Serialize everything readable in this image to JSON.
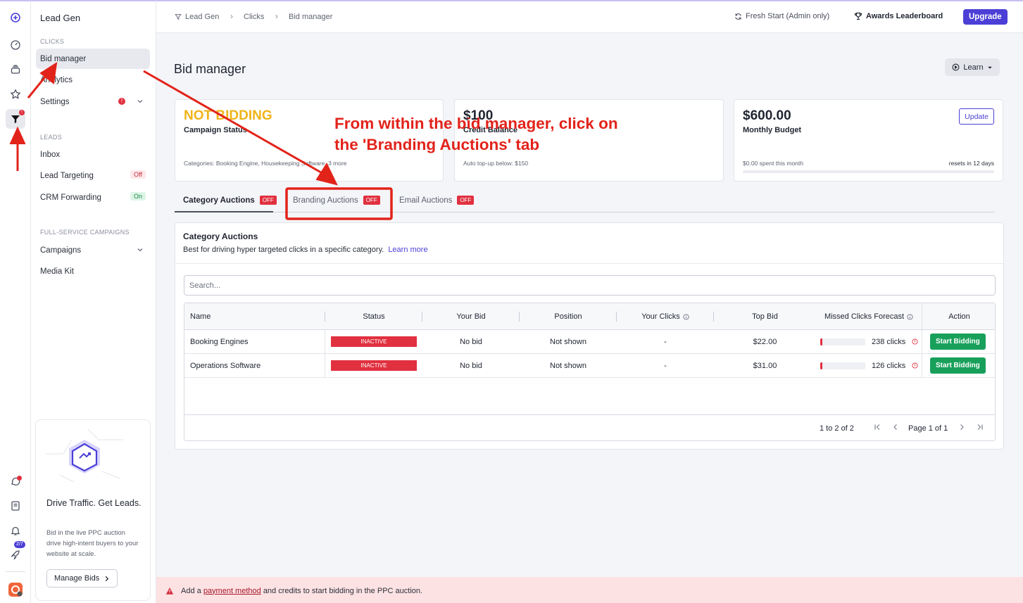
{
  "sidebar": {
    "title": "Lead Gen",
    "section_clicks": "CLICKS",
    "bid_manager": "Bid manager",
    "analytics": "Analytics",
    "settings": "Settings",
    "settings_badge": "!",
    "section_leads": "LEADS",
    "inbox": "Inbox",
    "lead_targeting": "Lead Targeting",
    "lead_targeting_tag": "Off",
    "crm_forwarding": "CRM Forwarding",
    "crm_forwarding_tag": "On",
    "section_campaigns": "FULL-SERVICE CAMPAIGNS",
    "campaigns": "Campaigns",
    "media_kit": "Media Kit",
    "promo_title": "Drive Traffic. Get Leads.",
    "promo_text": "Bid in the live PPC auction drive high-intent buyers to your website at scale.",
    "promo_button": "Manage Bids"
  },
  "rail": {
    "filter_badge": "!",
    "rocket_badge": "2/7"
  },
  "topbar": {
    "crumb_1": "Lead Gen",
    "crumb_2": "Clicks",
    "crumb_3": "Bid manager",
    "fresh_start": "Fresh Start (Admin only)",
    "awards": "Awards Leaderboard",
    "upgrade": "Upgrade"
  },
  "page": {
    "title": "Bid manager",
    "learn": "Learn"
  },
  "cards": {
    "status_value": "NOT BIDDING",
    "status_label": "Campaign Status",
    "status_foot": "Categories: Booking Engine, Housekeeping Software, 3 more",
    "credit_value": "$100",
    "credit_label": "Credit Balance",
    "credit_foot": "Auto top-up below:  $150",
    "budget_value": "$600.00",
    "budget_label": "Monthly Budget",
    "budget_update": "Update",
    "budget_foot_left": "$0.00 spent this month",
    "budget_foot_right": "resets in 12 days"
  },
  "tabs": [
    {
      "label": "Category Auctions",
      "badge": "OFF"
    },
    {
      "label": "Branding Auctions",
      "badge": "OFF"
    },
    {
      "label": "Email Auctions",
      "badge": "OFF"
    }
  ],
  "panel": {
    "title": "Category Auctions",
    "desc": "Best for driving hyper targeted clicks in a specific category.",
    "learn_more": "Learn more",
    "search_placeholder": "Search..."
  },
  "table": {
    "headers": [
      "Name",
      "Status",
      "Your Bid",
      "Position",
      "Your Clicks",
      "Top Bid",
      "Missed Clicks Forecast",
      "Action"
    ],
    "rows": [
      {
        "name": "Booking Engines",
        "status": "INACTIVE",
        "your_bid": "No bid",
        "position": "Not shown",
        "your_clicks": "-",
        "top_bid": "$22.00",
        "missed": "238 clicks",
        "missed_fraction": 0.05,
        "action": "Start Bidding"
      },
      {
        "name": "Operations Software",
        "status": "INACTIVE",
        "your_bid": "No bid",
        "position": "Not shown",
        "your_clicks": "-",
        "top_bid": "$31.00",
        "missed": "126 clicks",
        "missed_fraction": 0.05,
        "action": "Start Bidding"
      }
    ],
    "range": "1 to 2 of 2",
    "page_label": "Page 1 of 1"
  },
  "bottom_bar": {
    "text_before": "Add a",
    "link": "payment method",
    "text_after": "and credits to start bidding in the PPC auction."
  },
  "annotation": {
    "line_1": "From within the bid manager, click on",
    "line_2": "the 'Branding Auctions' tab",
    "color": "#e2231a"
  }
}
